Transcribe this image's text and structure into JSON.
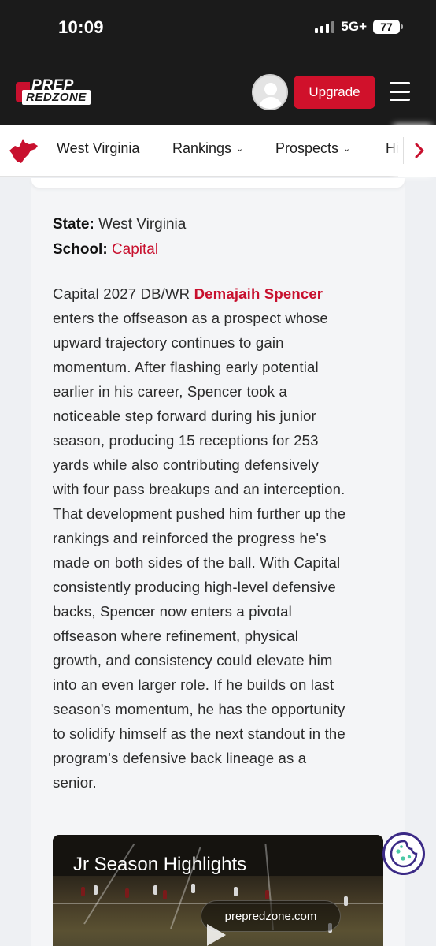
{
  "status_bar": {
    "time": "10:09",
    "network": "5G+",
    "battery": "77"
  },
  "header": {
    "logo_top": "PREP",
    "logo_bottom": "REDZONE",
    "upgrade_label": "Upgrade",
    "brand_color": "#c8102e"
  },
  "nav": {
    "items": [
      {
        "label": "West Virginia"
      },
      {
        "label": "Rankings"
      },
      {
        "label": "Prospects"
      },
      {
        "label": "Hi"
      }
    ]
  },
  "profile": {
    "state_label": "State:",
    "state_value": "West Virginia",
    "school_label": "School:",
    "school_value": "Capital"
  },
  "article": {
    "intro": "Capital 2027 DB/WR ",
    "player_link": "Demajaih Spencer",
    "lines": [
      "enters the offseason as a prospect whose",
      "upward trajectory continues to gain",
      "momentum. After flashing early potential",
      "earlier in his career, Spencer took a",
      "noticeable step forward during his junior",
      "season, producing 15 receptions for 253",
      "yards while also contributing defensively",
      "with four pass breakups and an interception.",
      "That development pushed him further up the",
      "rankings and reinforced the progress he's",
      "made on both sides of the ball. With Capital",
      "consistently producing high-level defensive",
      "backs, Spencer now enters a pivotal",
      "offseason where refinement, physical",
      "growth, and consistency could elevate him",
      "into an even larger role. If he builds on last",
      "season's momentum, he has the opportunity",
      "to solidify himself as the next standout in the",
      "program's defensive back lineage as a",
      "senior."
    ]
  },
  "video": {
    "title": "Jr Season Highlights",
    "source": "prepredzone.com"
  }
}
